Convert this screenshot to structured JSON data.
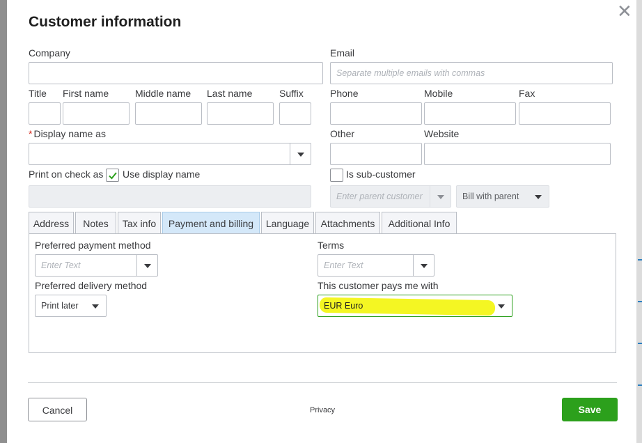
{
  "dialog": {
    "title": "Customer information"
  },
  "fields": {
    "company_label": "Company",
    "email_label": "Email",
    "email_placeholder": "Separate multiple emails with commas",
    "title_label": "Title",
    "first_name_label": "First name",
    "middle_name_label": "Middle name",
    "last_name_label": "Last name",
    "suffix_label": "Suffix",
    "phone_label": "Phone",
    "mobile_label": "Mobile",
    "fax_label": "Fax",
    "display_name_required": "*",
    "display_name_label": "Display name as",
    "other_label": "Other",
    "website_label": "Website",
    "print_on_check_label": "Print on check as",
    "use_display_name_label": "Use display name",
    "use_display_name_checked": true,
    "is_sub_customer_label": "Is sub-customer",
    "is_sub_customer_checked": false,
    "parent_customer_placeholder": "Enter parent customer",
    "bill_with_parent_value": "Bill with parent"
  },
  "tabs": [
    {
      "label": "Address",
      "active": false
    },
    {
      "label": "Notes",
      "active": false
    },
    {
      "label": "Tax info",
      "active": false
    },
    {
      "label": "Payment and billing",
      "active": true
    },
    {
      "label": "Language",
      "active": false
    },
    {
      "label": "Attachments",
      "active": false
    },
    {
      "label": "Additional Info",
      "active": false
    }
  ],
  "payment_billing": {
    "preferred_payment_label": "Preferred payment method",
    "preferred_payment_placeholder": "Enter Text",
    "terms_label": "Terms",
    "terms_placeholder": "Enter Text",
    "preferred_delivery_label": "Preferred delivery method",
    "preferred_delivery_value": "Print later",
    "pays_with_label": "This customer pays me with",
    "pays_with_value": "EUR Euro"
  },
  "footer": {
    "cancel_label": "Cancel",
    "privacy_label": "Privacy",
    "save_label": "Save"
  },
  "colors": {
    "primary": "#2ca01c",
    "highlight": "#f4f623",
    "active_tab": "#d4e8f9",
    "required": "#d52b1e"
  },
  "icons": [
    "close-icon",
    "checkmark-icon",
    "chevron-down-icon"
  ]
}
